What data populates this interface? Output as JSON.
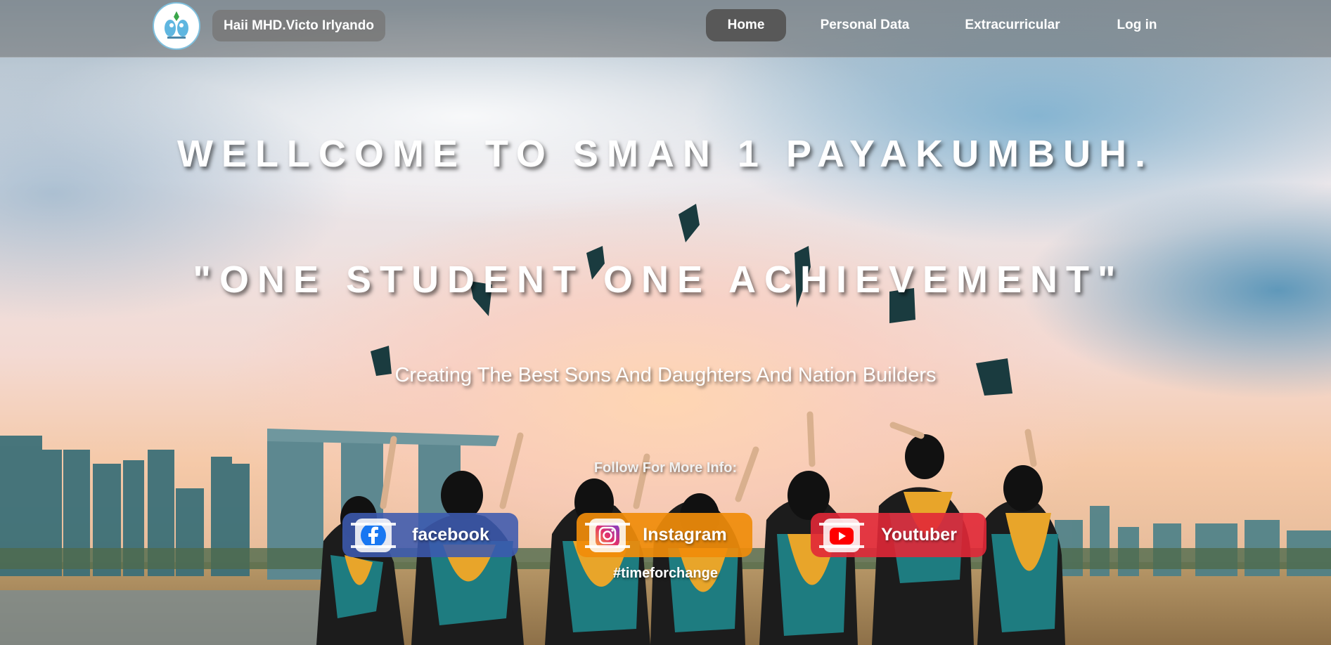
{
  "header": {
    "greeting": "Haii MHD.Victo Irlyando",
    "nav": [
      "Home",
      "Personal Data",
      "Extracurricular",
      "Log in"
    ],
    "active_nav": "Home"
  },
  "hero": {
    "title": "WELLCOME TO SMAN 1 PAYAKUMBUH.",
    "motto": "\"ONE STUDENT ONE ACHIEVEMENT\"",
    "subtitle": "Creating The Best Sons And Daughters And Nation Builders",
    "follow_text": "Follow For More Info:",
    "hashtag": "#timeforchange"
  },
  "social": [
    {
      "label": "facebook",
      "icon": "facebook-icon",
      "color": "#3c5aaf"
    },
    {
      "label": "Instagram",
      "icon": "instagram-icon",
      "color": "#f08c0a"
    },
    {
      "label": "Youtuber",
      "icon": "youtube-icon",
      "color": "#e12837"
    }
  ],
  "colors": {
    "nav_active": "#585858",
    "topbar": "#6e6e6e"
  }
}
